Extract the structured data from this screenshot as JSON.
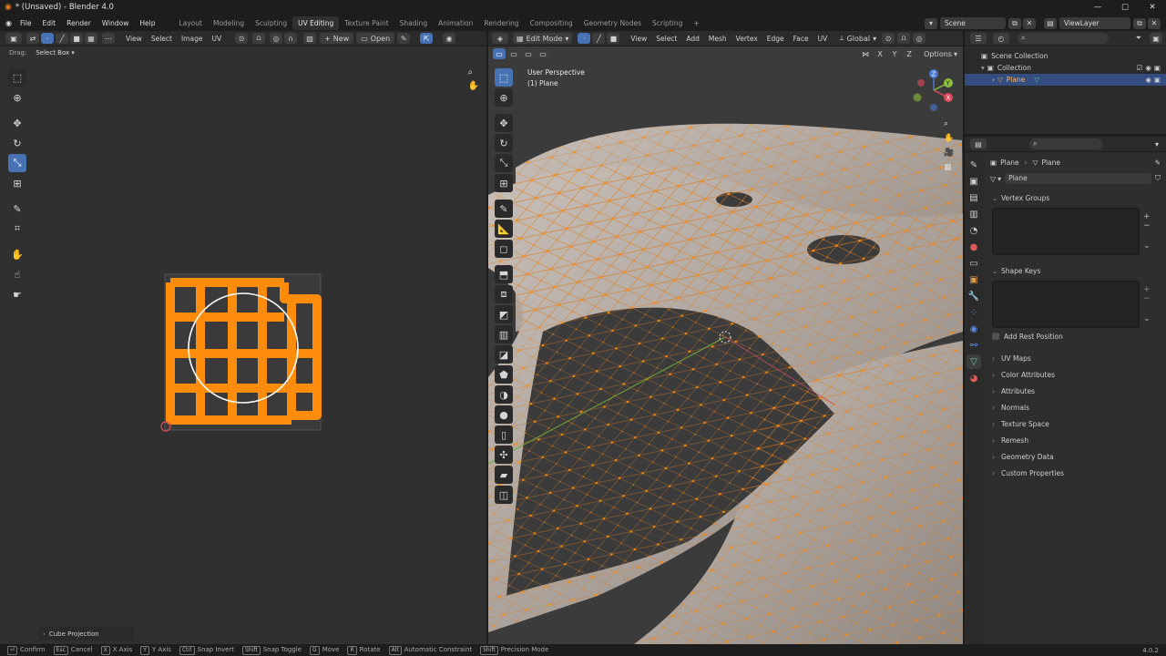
{
  "app": {
    "title": "* (Unsaved) - Blender 4.0",
    "version": "4.0.2"
  },
  "menu": [
    "File",
    "Edit",
    "Render",
    "Window",
    "Help"
  ],
  "workspaces": [
    "Layout",
    "Modeling",
    "Sculpting",
    "UV Editing",
    "Texture Paint",
    "Shading",
    "Animation",
    "Rendering",
    "Compositing",
    "Geometry Nodes",
    "Scripting"
  ],
  "scene": {
    "label": "Scene",
    "view_layer": "ViewLayer"
  },
  "uv_editor": {
    "menus": [
      "View",
      "Select",
      "Image",
      "UV"
    ],
    "new_label": "New",
    "open_label": "Open",
    "drag_label": "Drag:",
    "drag_value": "Select Box",
    "operator_panel": "Cube Projection"
  },
  "viewport": {
    "mode": "Edit Mode",
    "menus": [
      "View",
      "Select",
      "Add",
      "Mesh",
      "Vertex",
      "Edge",
      "Face",
      "UV"
    ],
    "orientation": "Global",
    "options_label": "Options",
    "axes": [
      "X",
      "Y",
      "Z"
    ],
    "perspective": "User Perspective",
    "object_info": "(1) Plane"
  },
  "outliner": {
    "root": "Scene Collection",
    "collection": "Collection",
    "object": "Plane"
  },
  "properties": {
    "breadcrumb_object": "Plane",
    "breadcrumb_data": "Plane",
    "data_name": "Plane",
    "sections": {
      "vertex_groups": "Vertex Groups",
      "shape_keys": "Shape Keys",
      "add_rest_position": "Add Rest Position",
      "uv_maps": "UV Maps",
      "color_attributes": "Color Attributes",
      "attributes": "Attributes",
      "normals": "Normals",
      "texture_space": "Texture Space",
      "remesh": "Remesh",
      "geometry_data": "Geometry Data",
      "custom_properties": "Custom Properties"
    }
  },
  "status": [
    {
      "key": "⏎",
      "label": "Confirm"
    },
    {
      "key": "Esc",
      "label": "Cancel"
    },
    {
      "key": "X",
      "label": "X Axis"
    },
    {
      "key": "Y",
      "label": "Y Axis"
    },
    {
      "key": "Ctrl",
      "label": "Snap Invert"
    },
    {
      "key": "Shift",
      "label": "Snap Toggle"
    },
    {
      "key": "G",
      "label": "Move"
    },
    {
      "key": "R",
      "label": "Rotate"
    },
    {
      "key": "Alt",
      "label": "Automatic Constraint"
    },
    {
      "key": "Shift",
      "label": "Precision Mode"
    }
  ],
  "colors": {
    "accent": "#4772b3",
    "selected": "#ff8c0a",
    "mesh_surface": "#b9b1aa"
  }
}
